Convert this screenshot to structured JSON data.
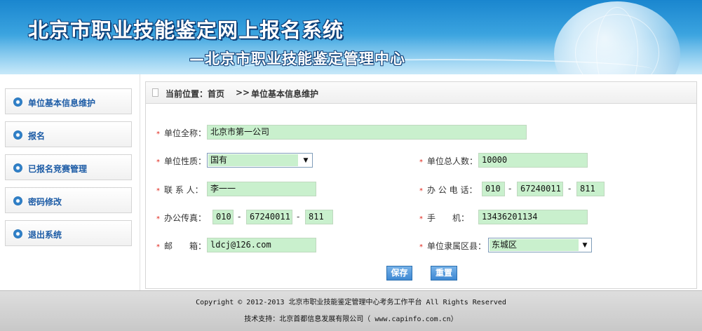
{
  "header": {
    "title": "北京市职业技能鉴定网上报名系统",
    "subtitle": "—北京市职业技能鉴定管理中心"
  },
  "sidebar": {
    "items": [
      {
        "label": "单位基本信息维护"
      },
      {
        "label": "报名"
      },
      {
        "label": "已报名竞赛管理"
      },
      {
        "label": "密码修改"
      },
      {
        "label": "退出系统"
      }
    ]
  },
  "breadcrumb": {
    "prefix": "当前位置：首页",
    "separator": ">>",
    "current": "单位基本信息维护"
  },
  "form": {
    "required_mark": "*",
    "unit_name": {
      "label": "单位全称：",
      "value": "北京市第一公司"
    },
    "unit_type": {
      "label": "单位性质：",
      "value": "国有"
    },
    "total_staff": {
      "label": "单位总人数：",
      "value": "10000"
    },
    "contact": {
      "label": "联 系 人：",
      "value": "李一一"
    },
    "office_phone": {
      "label": "办 公 电 话：",
      "area": "010",
      "number": "67240011",
      "ext": "811"
    },
    "fax": {
      "label": "办公传真：",
      "area": "010",
      "number": "67240011",
      "ext": "811"
    },
    "mobile": {
      "label": "手　　机：",
      "value": "13436201134"
    },
    "email": {
      "label": "邮　　箱：",
      "value": "ldcj@126.com"
    },
    "district": {
      "label": "单位隶属区县：",
      "value": "东城区"
    },
    "dash": "-",
    "save_label": "保存",
    "reset_label": "重置"
  },
  "footer": {
    "copyright": "Copyright © 2012-2013 北京市职业技能鉴定管理中心考务工作平台 All Rights Reserved",
    "support": "技术支持：北京首都信息发展有限公司（ www.capinfo.com.cn）"
  },
  "colors": {
    "input_bg": "#c9f0cd",
    "menu_text": "#1d5ca6",
    "required": "#e0261b",
    "button": "#3d88d3"
  }
}
